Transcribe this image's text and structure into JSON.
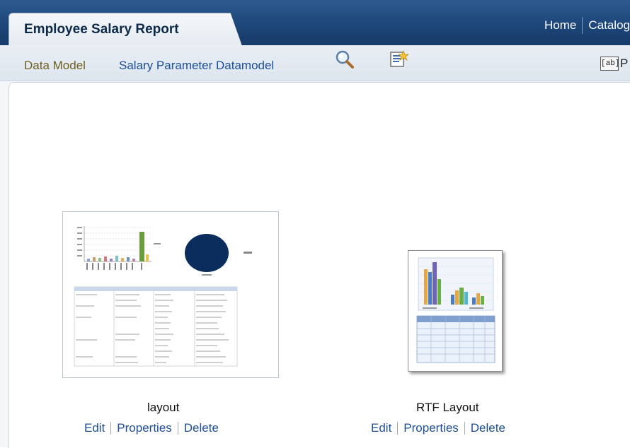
{
  "header": {
    "title": "Employee Salary Report",
    "nav": [
      "Home",
      "Catalog"
    ]
  },
  "toolbar": {
    "data_model_label": "Data Model",
    "data_model_link": "Salary Parameter Datamodel",
    "search_icon": "magnifier-icon",
    "properties_icon": "report-properties-icon",
    "field_button_text": "[ab]",
    "field_button_label_partial": "P"
  },
  "layouts": [
    {
      "name": "layout",
      "actions": [
        "Edit",
        "Properties",
        "Delete"
      ]
    },
    {
      "name": "RTF Layout",
      "actions": [
        "Edit",
        "Properties",
        "Delete"
      ]
    }
  ],
  "colors": {
    "header_blue": "#1d4679",
    "link_blue": "#1d4f99",
    "data_model_label": "#6e5f1f"
  }
}
